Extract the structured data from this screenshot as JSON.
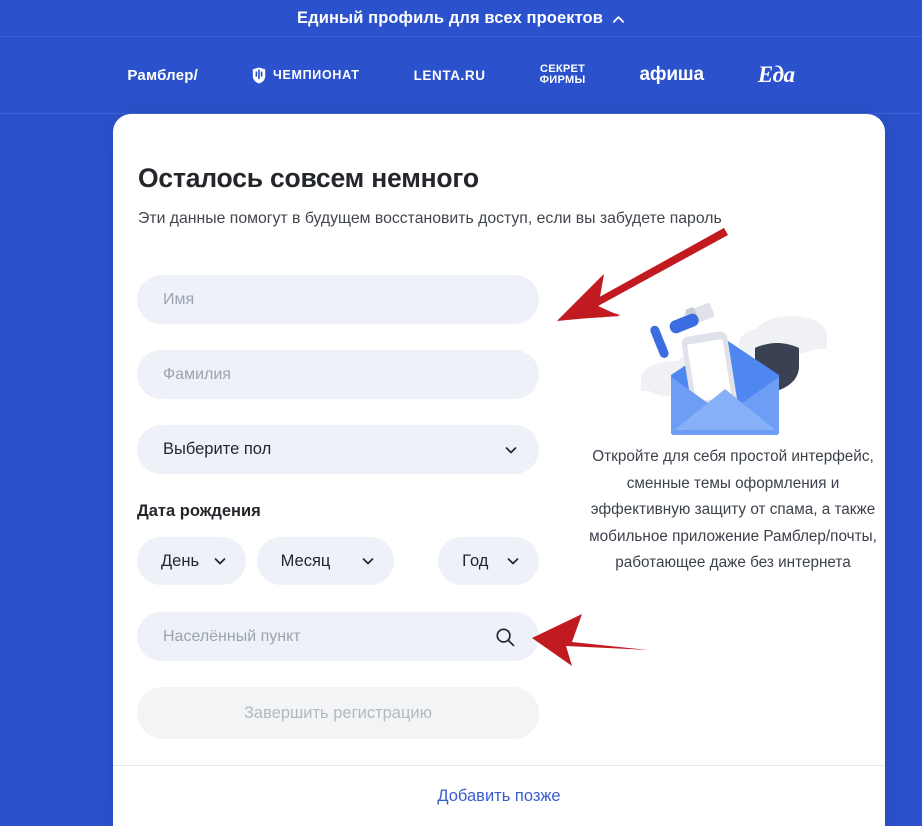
{
  "theme": {
    "background_blue": "#2b52cc",
    "card_white": "#ffffff",
    "field_bg": "#eef2f8",
    "link_blue": "#3a5bd0",
    "arrow_red": "#c11a20",
    "placeholder_grey": "#9aa3b0"
  },
  "topbar": {
    "title": "Единый профиль для всех проектов",
    "toggle_icon": "chevron-up-icon"
  },
  "brandnav": {
    "items": [
      {
        "label": "Рамблер/",
        "icon": null
      },
      {
        "label": "ЧЕМПИОНАТ",
        "icon": "shield-icon"
      },
      {
        "label": "LENTA.RU",
        "icon": null
      },
      {
        "label_line1": "СЕКРЕТ",
        "label_line2": "ФИРМЫ",
        "icon": null
      },
      {
        "label": "афиша",
        "icon": null
      },
      {
        "label": "Еда",
        "icon": null
      }
    ]
  },
  "card": {
    "title": "Осталось совсем немного",
    "subtitle": "Эти данные помогут в будущем восстановить доступ, если вы забудете пароль",
    "form": {
      "first_name": {
        "placeholder": "Имя",
        "value": ""
      },
      "last_name": {
        "placeholder": "Фамилия",
        "value": ""
      },
      "gender": {
        "label": "Выберите пол",
        "icon": "chevron-down-icon"
      },
      "dob_label": "Дата рождения",
      "dob": {
        "day": {
          "label": "День",
          "icon": "chevron-down-icon"
        },
        "month": {
          "label": "Месяц",
          "icon": "chevron-down-icon"
        },
        "year": {
          "label": "Год",
          "icon": "chevron-down-icon"
        }
      },
      "city": {
        "placeholder": "Населённый пункт",
        "value": "",
        "icon": "search-icon"
      },
      "submit": {
        "label": "Завершить регистрацию",
        "enabled": false
      }
    },
    "promo": {
      "illustration": "envelope-with-phone-shield-brush-illustration",
      "text": "Откройте для себя простой интерфейс, сменные темы оформления и эффективную защиту от спама, а также мобильное приложение Рамблер/почты, работающее даже без интернета"
    },
    "footer": {
      "later_link": "Добавить позже"
    }
  },
  "annotations": {
    "arrows": [
      {
        "name": "arrow-pointing-to-form-fields",
        "direction": "down-left"
      },
      {
        "name": "arrow-pointing-to-city-field",
        "direction": "left"
      }
    ]
  }
}
